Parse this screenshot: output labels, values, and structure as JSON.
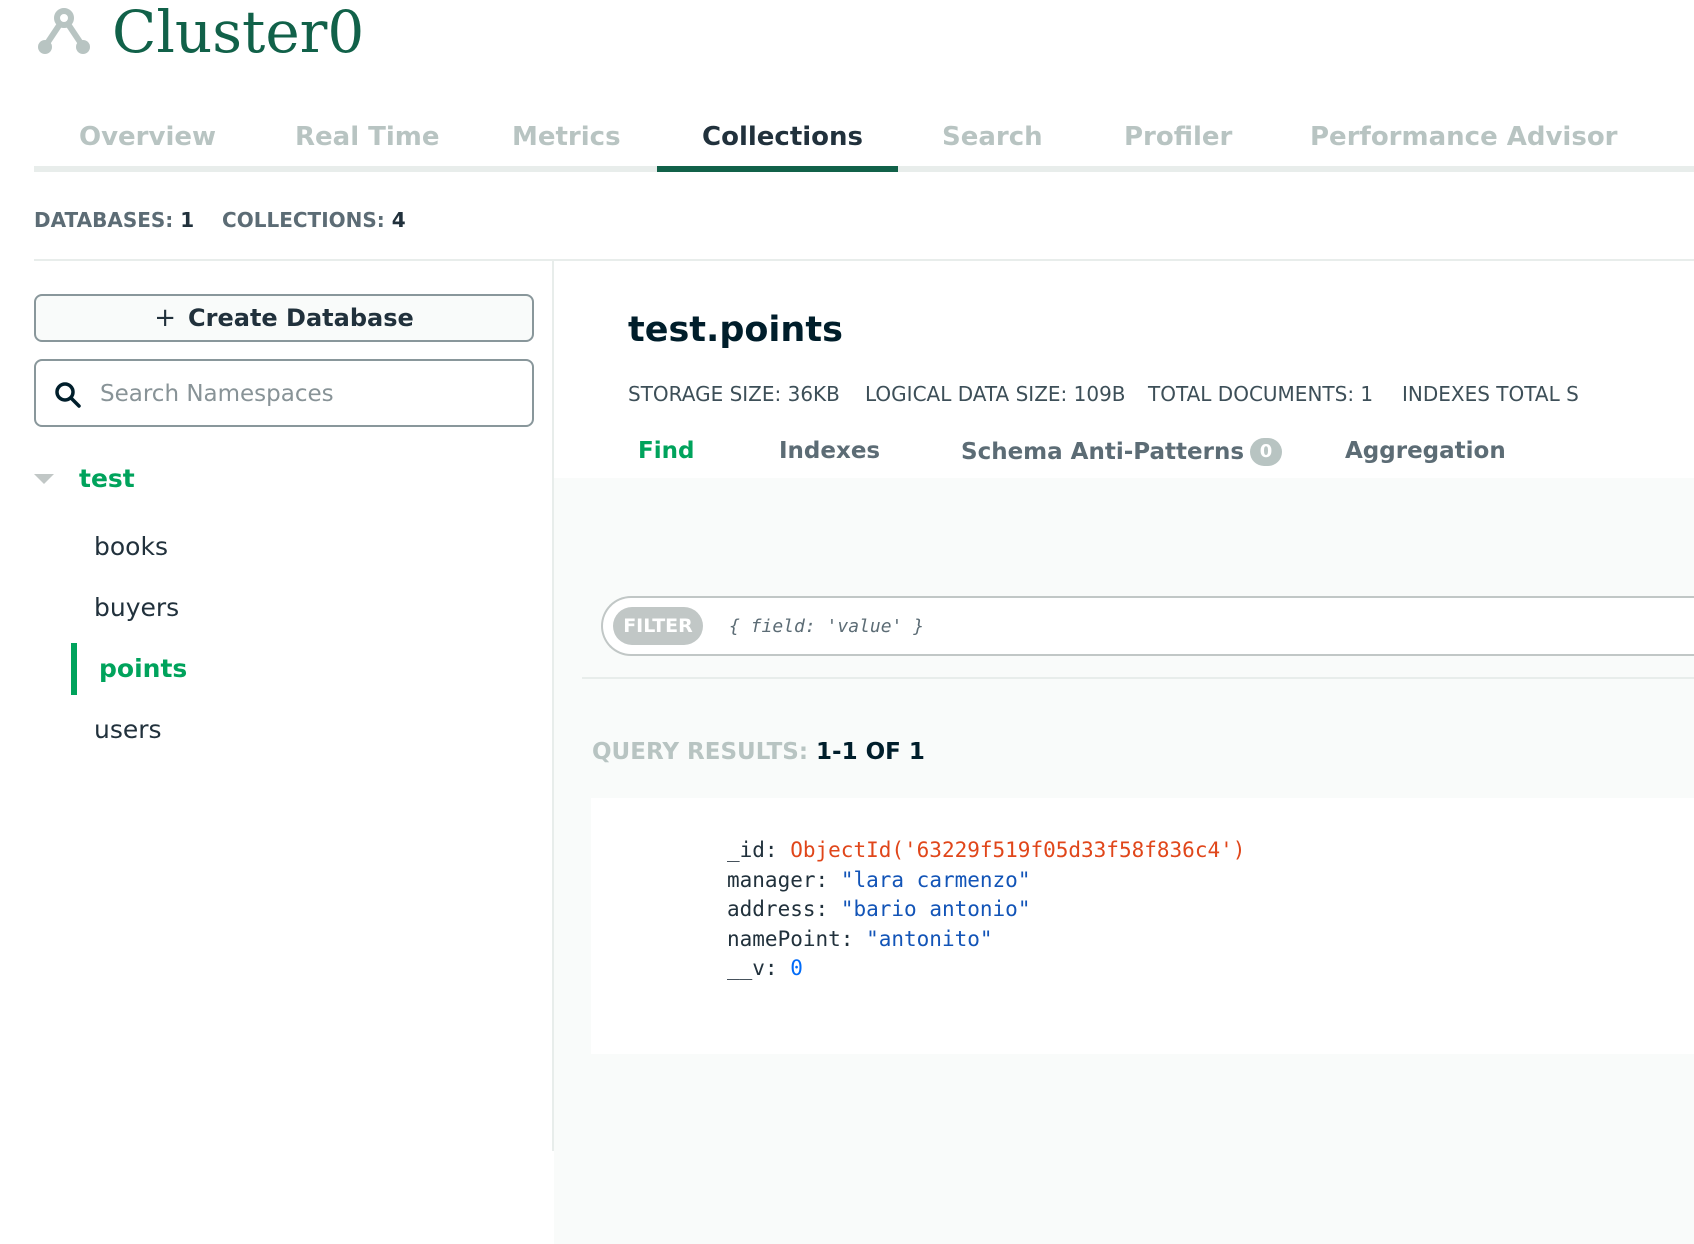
{
  "header": {
    "title": "Cluster0",
    "icon": "cluster-icon"
  },
  "tabs": [
    {
      "label": "Overview",
      "active": false
    },
    {
      "label": "Real Time",
      "active": false
    },
    {
      "label": "Metrics",
      "active": false
    },
    {
      "label": "Collections",
      "active": true
    },
    {
      "label": "Search",
      "active": false
    },
    {
      "label": "Profiler",
      "active": false
    },
    {
      "label": "Performance Advisor",
      "active": false
    }
  ],
  "counts": {
    "databases_label": "DATABASES:",
    "databases_value": "1",
    "collections_label": "COLLECTIONS:",
    "collections_value": "4"
  },
  "sidebar": {
    "create_button": {
      "icon": "+",
      "label": "Create Database"
    },
    "search_placeholder": "Search Namespaces",
    "database": "test",
    "collections": [
      "books",
      "buyers",
      "points",
      "users"
    ],
    "active_collection": "points"
  },
  "main": {
    "namespace": "test.points",
    "stats": [
      {
        "label": "STORAGE SIZE:",
        "value": "36KB"
      },
      {
        "label": "LOGICAL DATA SIZE:",
        "value": "109B"
      },
      {
        "label": "TOTAL DOCUMENTS:",
        "value": "1"
      },
      {
        "label": "INDEXES TOTAL S",
        "value": ""
      }
    ],
    "subtabs": [
      {
        "label": "Find",
        "active": true
      },
      {
        "label": "Indexes",
        "active": false
      },
      {
        "label": "Schema Anti-Patterns",
        "badge": "0",
        "active": false
      },
      {
        "label": "Aggregation",
        "active": false
      }
    ],
    "filter": {
      "pill": "FILTER",
      "placeholder": "{ field: 'value' }"
    },
    "results": {
      "label": "QUERY RESULTS:",
      "value": "1-1 OF 1"
    },
    "document": {
      "id_key": "_id:",
      "id_value": "ObjectId('63229f519f05d33f58f836c4')",
      "manager_key": "manager:",
      "manager_value": "\"lara carmenzo\"",
      "address_key": "address:",
      "address_value": "\"bario antonio\"",
      "namepoint_key": "namePoint:",
      "namepoint_value": "\"antonito\"",
      "v_key": "__v:",
      "v_value": "0"
    }
  },
  "colors": {
    "brand_green": "#116149",
    "accent_green": "#00a35c",
    "objectid": "#e0461a",
    "string": "#1254b7"
  }
}
